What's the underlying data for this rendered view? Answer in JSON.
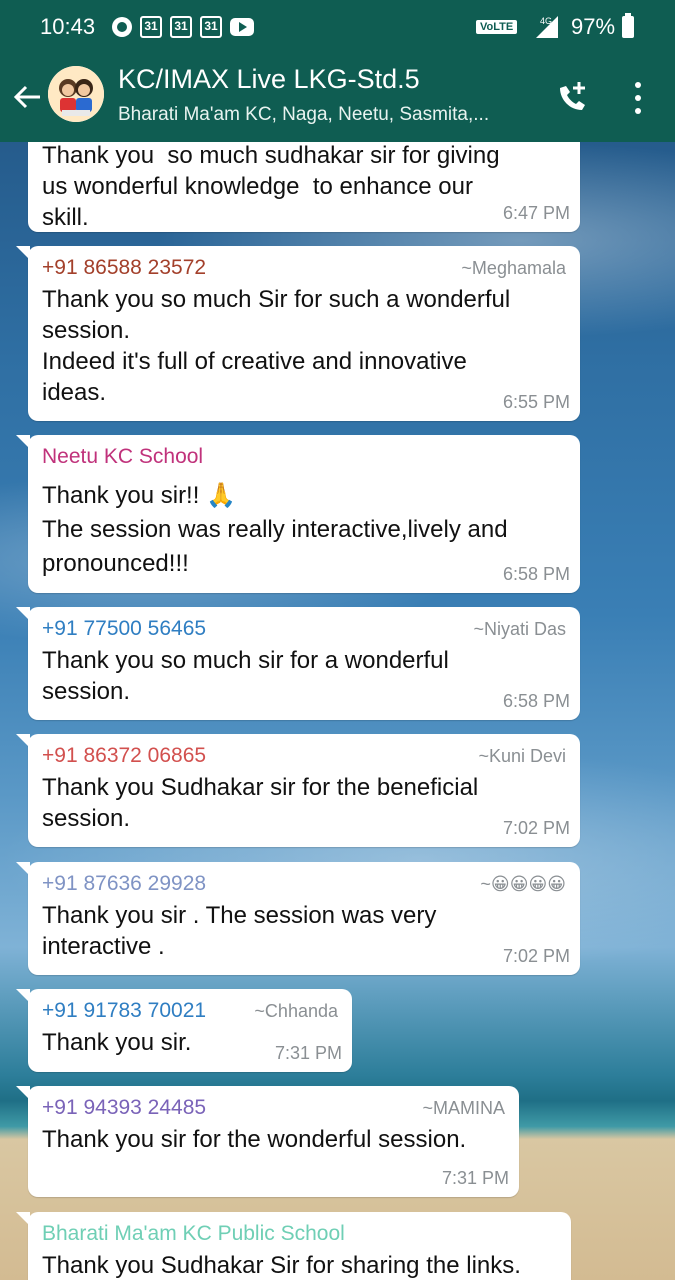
{
  "status_bar": {
    "time": "10:43",
    "calendar_day": "31",
    "network_badge": "VoLTE",
    "network_type": "4G",
    "battery": "97%"
  },
  "header": {
    "title": "KC/IMAX Live LKG-Std.5",
    "subtitle": "Bharati Ma'am KC, Naga, Neetu, Sasmita,...",
    "back_icon": "arrow-left-icon",
    "call_icon": "add-call-icon",
    "menu_icon": "more-vert-icon"
  },
  "messages": [
    {
      "sender": "",
      "alias": "",
      "text": "Thank you  so much sudhakar sir for giving\nus wonderful knowledge  to enhance our\nskill.",
      "time": "6:47 PM",
      "color": "#111111"
    },
    {
      "sender": "+91 86588 23572",
      "alias": "~Meghamala",
      "text": "Thank you so much Sir for such a wonderful\nsession.\nIndeed it's full of creative and innovative\nideas.",
      "time": "6:55 PM",
      "color": "#a3402b"
    },
    {
      "sender": "Neetu KC School",
      "alias": "",
      "text": "Thank you sir!! 🙏\nThe session was really interactive,lively and\npronounced!!!",
      "time": "6:58 PM",
      "color": "#c0327b"
    },
    {
      "sender": "+91 77500 56465",
      "alias": "~Niyati Das",
      "text": "Thank you so much sir for a wonderful\nsession.",
      "time": "6:58 PM",
      "color": "#2f7ec2"
    },
    {
      "sender": "+91 86372 06865",
      "alias": "~Kuni Devi",
      "text": "Thank you Sudhakar sir for the beneficial\nsession.",
      "time": "7:02 PM",
      "color": "#d2504e"
    },
    {
      "sender": "+91 87636 29928",
      "alias": "~😀😀😀😀",
      "text": "Thank you sir . The session was very\ninteractive .",
      "time": "7:02 PM",
      "color": "#7f93c4"
    },
    {
      "sender": "+91 91783 70021",
      "alias": "~Chhanda",
      "text": "Thank you sir.",
      "time": "7:31 PM",
      "color": "#2f7ec2"
    },
    {
      "sender": "+91 94393 24485",
      "alias": "~MAMINA",
      "text": "Thank you sir for the wonderful session.",
      "time": "7:31 PM",
      "color": "#7a63b8"
    },
    {
      "sender": "Bharati Ma'am KC Public School",
      "alias": "",
      "text": "Thank you Sudhakar Sir for sharing the links.",
      "time": "",
      "color": "#6fcfb5"
    }
  ]
}
